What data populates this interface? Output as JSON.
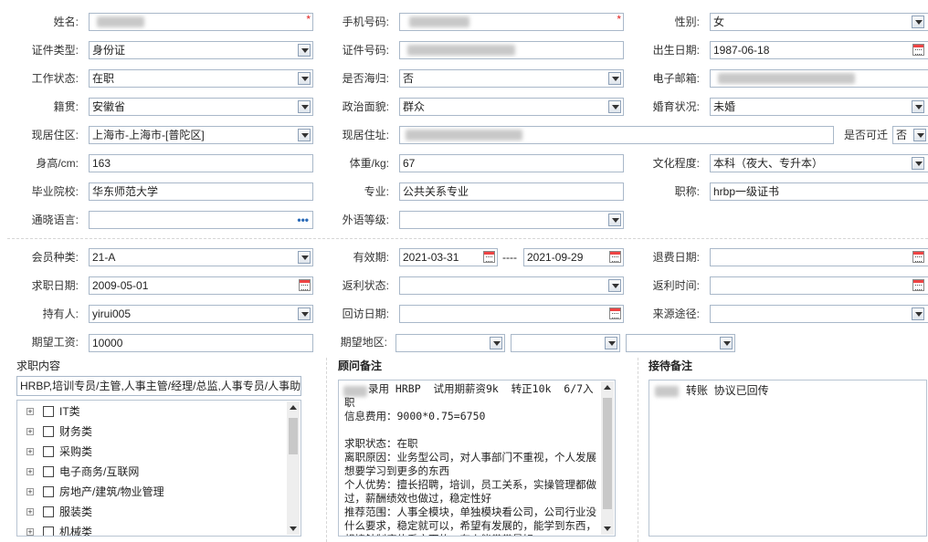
{
  "form": {
    "name_label": "姓名:",
    "phone_label": "手机号码:",
    "gender_label": "性别:",
    "gender_value": "女",
    "idtype_label": "证件类型:",
    "idtype_value": "身份证",
    "idno_label": "证件号码:",
    "birth_label": "出生日期:",
    "birth_value": "1987-06-18",
    "work_label": "工作状态:",
    "work_value": "在职",
    "overseas_label": "是否海归:",
    "overseas_value": "否",
    "email_label": "电子邮箱:",
    "native_label": "籍贯:",
    "native_value": "安徽省",
    "political_label": "政治面貌:",
    "political_value": "群众",
    "marital_label": "婚育状况:",
    "marital_value": "未婚",
    "region_label": "现居住区:",
    "region_value": "上海市-上海市-[普陀区]",
    "address_label": "现居住址:",
    "relocate_label": "是否可迁",
    "relocate_value": "否",
    "height_label": "身高/cm:",
    "height_value": "163",
    "weight_label": "体重/kg:",
    "weight_value": "67",
    "edu_label": "文化程度:",
    "edu_value": "本科（夜大、专升本）",
    "school_label": "毕业院校:",
    "school_value": "华东师范大学",
    "major_label": "专业:",
    "major_value": "公共关系专业",
    "title_label": "职称:",
    "title_value": "hrbp一级证书",
    "lang_label": "通晓语言:",
    "lang_dots": "•••",
    "fl_label": "外语等级:"
  },
  "member": {
    "type_label": "会员种类:",
    "type_value": "21-A",
    "valid_label": "有效期:",
    "valid_from": "2021-03-31",
    "valid_sep": "----",
    "valid_to": "2021-09-29",
    "refund_label": "退费日期:",
    "apply_label": "求职日期:",
    "apply_value": "2009-05-01",
    "rebate_state_label": "返利状态:",
    "rebate_time_label": "返利时间:",
    "holder_label": "持有人:",
    "holder_value": "yirui005",
    "visit_label": "回访日期:",
    "source_label": "来源途径:",
    "salary_label": "期望工资:",
    "salary_value": "10000",
    "area_label": "期望地区:"
  },
  "job": {
    "section_title": "求职内容",
    "selected": "HRBP,培训专员/主管,人事主管/经理/总监,人事专员/人事助",
    "tree": [
      {
        "label": "IT类"
      },
      {
        "label": "财务类"
      },
      {
        "label": "采购类"
      },
      {
        "label": "电子商务/互联网"
      },
      {
        "label": "房地产/建筑/物业管理"
      },
      {
        "label": "服装类"
      },
      {
        "label": "机械类"
      }
    ]
  },
  "advisor": {
    "section_title": "顾问备注",
    "text": "录用 HRBP  试用期薪资9k  转正10k  6/7入职\n信息费用：9000*0.75=6750\n\n求职状态：在职\n离职原因：业务型公司，对人事部门不重视，个人发展想要学习到更多的东西\n个人优势：擅长招聘，培训，员工关系，实操管理都做过，薪酬绩效也做过，稳定性好\n推荐范围：人事全模块，单独模块看公司，公司行业没什么要求，稳定就可以，希望有发展的，能学到东西，想接触制度体系方面的，有人能带带最好"
  },
  "reception": {
    "section_title": "接待备注",
    "text": "转账  协议已回传"
  }
}
